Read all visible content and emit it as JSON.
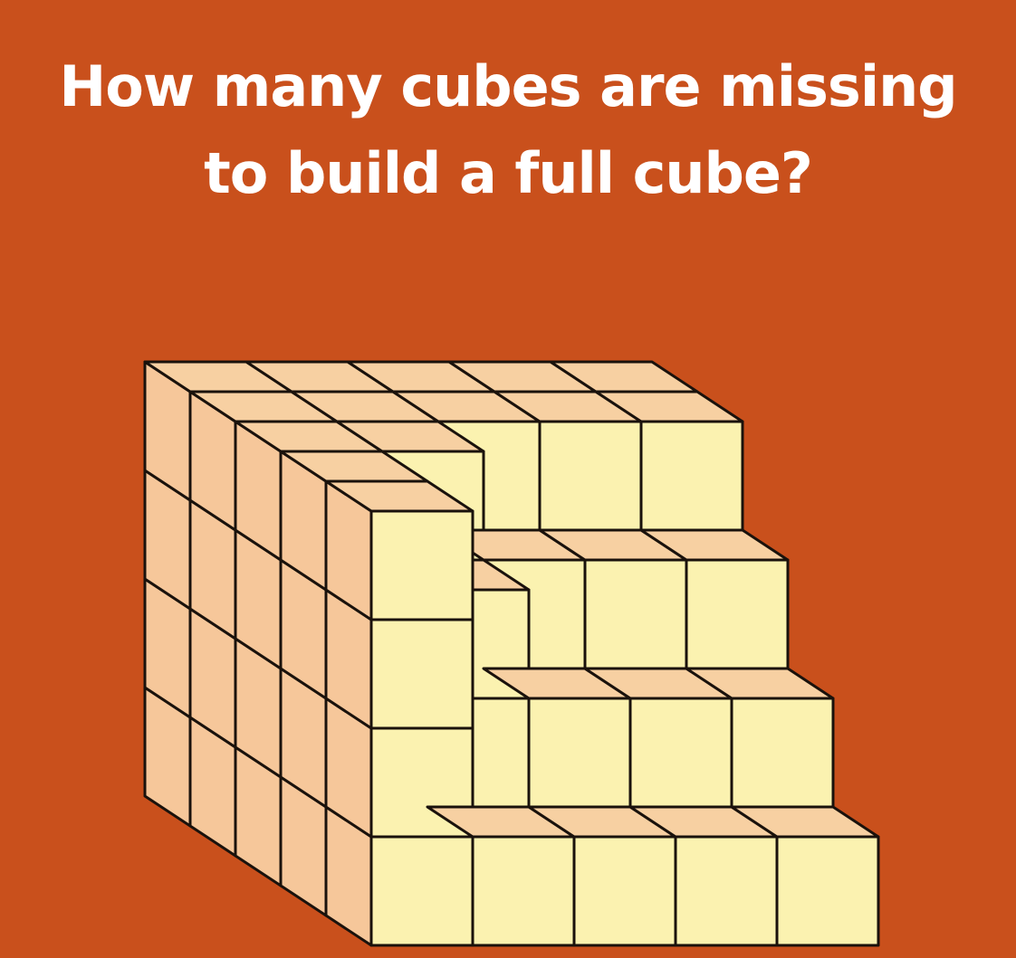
{
  "puzzle": {
    "title_line_1": "How many cubes are missing",
    "title_line_2": "to build a full cube?"
  },
  "colors": {
    "background": "#c9501c",
    "title_text": "#ffffff",
    "cube_front": "#fbf2b0",
    "cube_top": "#f7d0a2",
    "cube_side": "#f6c79a",
    "outline": "#1a120c"
  },
  "structure": {
    "full_cube_size": 5,
    "icon": "staircase-cube-figure"
  }
}
